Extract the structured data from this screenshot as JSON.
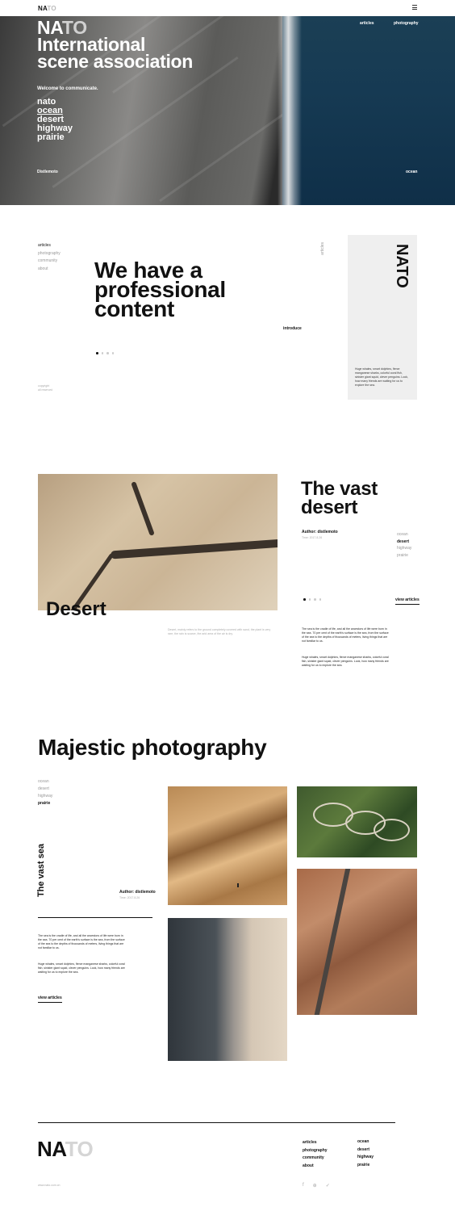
{
  "topbar": {
    "logo_na": "NA",
    "logo_to": "TO"
  },
  "hero": {
    "title_na": "NA",
    "title_to": "TO",
    "title_line2": "International",
    "title_line3": "scene association",
    "welcome": "Welcome to communicate.",
    "categories": [
      "nato",
      "ocean",
      "desert",
      "highway",
      "prairie"
    ],
    "nav": [
      "articles",
      "photography"
    ],
    "footer_left": "Distlemoto",
    "footer_right": "ocean"
  },
  "intro": {
    "nav": [
      "articles",
      "photography",
      "community",
      "about"
    ],
    "headline": [
      "We have a",
      "professional",
      "content"
    ],
    "vertical_label": "articles",
    "introduce": "introduce",
    "small_text": [
      "copyright",
      "all reserved"
    ],
    "card_logo": "NATO",
    "card_text": "Huge whales, smart dolphins, fierce manganese sharks, colorful coral fish, sinister giant squid, clever penguins. Look, how many friends are waiting for us to explore the sea."
  },
  "desert": {
    "image_label": "Desert",
    "caption": "Desert, mainly refers to the ground completely covered with sand, the plant is very rare, the rain is scarce, the arid area of the air is dry.",
    "title": [
      "The vast",
      "desert"
    ],
    "author": "Author: distlemoto",
    "time": "Time: 2017.8.26",
    "categories": [
      "ocean",
      "desert",
      "highway",
      "prairie"
    ],
    "view": "view articles",
    "para1": "The sea is the cradle of life, and all the ancestors of life were born in the sea. 70 per cent of the earth's surface is the sea, from the surface of the sea to the depths of thousands of meters, living things that are not familiar to us.",
    "para2": "Huge whales, smart dolphins, fierce manganese sharks, colorful coral fish, sinister giant squid, clever penguins. Look, how many friends are waiting for us to explore the sea."
  },
  "photo": {
    "title": "Majestic photography",
    "categories": [
      "ocean",
      "desert",
      "highway",
      "prairie"
    ],
    "vertical_title": "The vast sea",
    "author": "Author: distlemoto",
    "time": "Time: 2017.8.26",
    "para1": "The sea is the cradle of life, and all the ancestors of life were born in the sea. 70 per cent of the earth's surface is the sea, from the surface of the sea to the depths of thousands of meters, living things that are not familiar to us.",
    "para2": "Huge whales, smart dolphins, fierce manganese sharks, colorful coral fish, sinister giant squid, clever penguins. Look, how many friends are waiting for us to explore the sea.",
    "view": "view articles"
  },
  "footer": {
    "logo_na": "NA",
    "logo_to": "TO",
    "nav1": [
      "articles",
      "photography",
      "community",
      "about"
    ],
    "nav2": [
      "ocean",
      "desert",
      "highway",
      "prairie"
    ],
    "url": "www.nato.com.cn",
    "social": [
      {
        "icon": "facebook-icon",
        "glyph": "f"
      },
      {
        "icon": "weibo-icon",
        "glyph": "⊕"
      },
      {
        "icon": "twitter-icon",
        "glyph": "✓"
      }
    ]
  },
  "colors": {
    "text": "#111111",
    "muted": "#999999",
    "card_bg": "#efefef",
    "logo_light": "#d5d5d5"
  }
}
